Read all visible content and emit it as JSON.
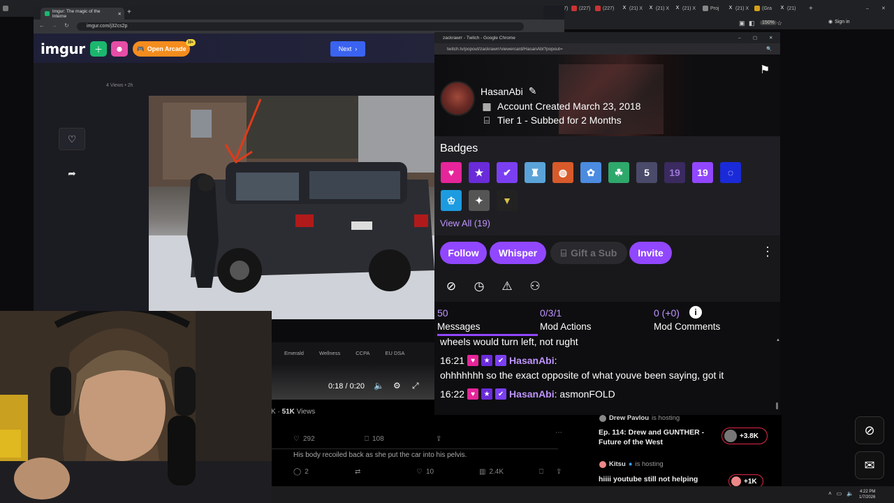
{
  "outer_browser": {
    "tabs": [
      "(227)",
      "(227)",
      "(227)",
      "(21) X",
      "(21) X",
      "(21) X",
      "(21) R",
      "Proj",
      "(21) X",
      "(Gra",
      "(21)"
    ],
    "zoom": "150%",
    "sign_in": "Sign in"
  },
  "imgur_browser": {
    "tab_title": "Imgur: The magic of the Interne",
    "url": "imgur.com/j32cs2p",
    "logo": "imgur",
    "open_arcade": "Open Arcade",
    "arcade_badge": "10+",
    "next_button": "Next",
    "views_small": "4 Views • 2h",
    "footer_links": [
      "Emerald",
      "Wellness",
      "CCPA",
      "EU DSA"
    ],
    "video_time": "0:18 / 0:20"
  },
  "social": {
    "views_prefix": "K · ",
    "views_count": "51K",
    "views_label": " Views",
    "likes": "292",
    "bookmarks": "108",
    "reply_text": "His body recoiled back as she put the car into his pelvis.",
    "replies": "2",
    "likes2": "10",
    "views2": "2.4K"
  },
  "hosting": {
    "item1_name": "Drew Pavlou",
    "item1_status": "is hosting",
    "item1_title": "Ep. 114: Drew and GUNTHER -",
    "item1_title2": "Future of the West",
    "item1_count": "+3.8K",
    "item2_name": "Kitsu",
    "item2_status": "is hosting",
    "item2_title": "hiiii youtube still not helping",
    "item2_count": "+1K"
  },
  "taskbar": {
    "time": "4:22 PM",
    "date": "1/7/2026"
  },
  "twitch": {
    "window_title": "zackrawrr - Twitch - Google Chrome",
    "url": "twitch.tv/popout/zackrawrr/viewercard/HasanAbi?popout=",
    "username": "HasanAbi",
    "account_created": "Account Created March 23, 2018",
    "sub_info": "Tier 1 - Subbed for 2 Months",
    "badges_title": "Badges",
    "view_all": "View All (19)",
    "buttons": {
      "follow": "Follow",
      "whisper": "Whisper",
      "gift": "Gift a Sub",
      "invite": "Invite"
    },
    "stats": [
      {
        "num": "50",
        "label": "Messages"
      },
      {
        "num": "0/3/1",
        "label": "Mod Actions"
      },
      {
        "num": "0 (+0)",
        "label": "Mod Comments"
      }
    ],
    "chat": [
      {
        "time": "",
        "name": "",
        "text": "wheels would turn left, not rught"
      },
      {
        "time": "16:21",
        "name": "HasanAbi",
        "text": ":"
      },
      {
        "time": "",
        "name": "",
        "text": "ohhhhhhh so the exact opposite of what youve been saying, got it"
      },
      {
        "time": "16:22",
        "name": "HasanAbi",
        "text": ": asmonFOLD"
      }
    ]
  },
  "colors": {
    "twitch_purple": "#9147ff",
    "twitch_light_purple": "#bf94ff",
    "imgur_green": "#1bb76e",
    "arcade_orange": "#f58d1e"
  }
}
